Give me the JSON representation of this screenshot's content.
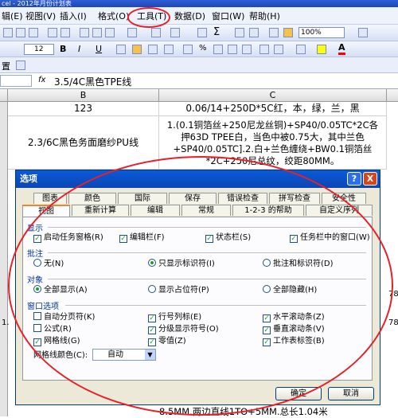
{
  "window": {
    "title": "cel - 2012年月份计划表"
  },
  "menu": {
    "items": [
      "辑(E)",
      "视图(V)",
      "插入(I)",
      "格式(O)",
      "工具(T)",
      "数据(D)",
      "窗口(W)",
      "帮助(H)"
    ]
  },
  "toolbar": {
    "zoom": "100%",
    "font_size": "12",
    "fill_color": "#ffff00",
    "font_color": "#ff0000"
  },
  "toolbar3": {
    "label": "置"
  },
  "formula_bar": {
    "fx": "fx",
    "content": "3.5/4C黑色TPE线"
  },
  "columns": [
    "B",
    "C"
  ],
  "grid": {
    "r1": {
      "b": "123",
      "c": "0.06/14+250D*5C红，本，绿，兰，黑"
    },
    "r2": {
      "b": "2.3/6C黑色务面磨纱PU线",
      "c_line1": "1.(0.1铜箔丝+250尼龙丝铜)+SP40/0.05TC*2C各",
      "c_line2": "押63D TPEE白，当色中被0.75大，其中兰色",
      "c_line3": "+SP40/0.05TC].2.白+兰色缠绕+BW0.1铜箔丝",
      "c_line4": "*2C+250尼总纹，绞距80MM。"
    },
    "side_values": [
      "78",
      "1.",
      "78"
    ],
    "bottom": "8.5MM.两边直线1TO+5MM.总长1.04米"
  },
  "dialog": {
    "title": "选项",
    "help_btn": "?",
    "close_btn": "X",
    "tabs_row1": [
      "图表",
      "颜色",
      "国际",
      "保存",
      "错误检查",
      "拼写检查",
      "安全性"
    ],
    "tabs_row2": [
      "视图",
      "重新计算",
      "编辑",
      "常规",
      "1-2-3 的帮助",
      "自定义序列"
    ],
    "display": {
      "label": "显示",
      "options": [
        "启动任务窗格(R)",
        "编辑栏(F)",
        "状态栏(S)",
        "任务栏中的窗口(W)"
      ]
    },
    "comments": {
      "label": "批注",
      "options": [
        "无(N)",
        "只显示标识符(I)",
        "批注和标识符(D)"
      ]
    },
    "objects": {
      "label": "对象",
      "options": [
        "全部显示(A)",
        "显示占位符(P)",
        "全部隐藏(H)"
      ]
    },
    "window_opts": {
      "label": "窗口选项",
      "options": [
        "自动分页符(K)",
        "公式(R)",
        "网格线(G)",
        "行号列标(E)",
        "分级显示符号(O)",
        "零值(Z)",
        "水平滚动条(Z)",
        "垂直滚动条(V)",
        "工作表标签(B)"
      ]
    },
    "gridline_color": {
      "label": "网格线颜色(C):",
      "value": "自动"
    },
    "ok": "确定",
    "cancel": "取消"
  },
  "annotation": {
    "color": "#e8202a"
  }
}
